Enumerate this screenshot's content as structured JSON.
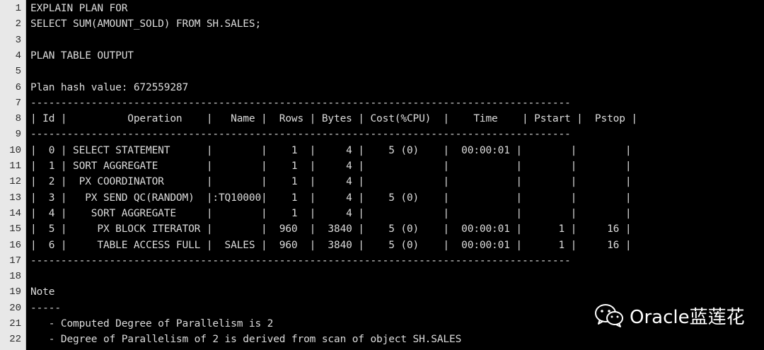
{
  "editor": {
    "lines": [
      {
        "num": "1",
        "text": "EXPLAIN PLAN FOR"
      },
      {
        "num": "2",
        "text": "SELECT SUM(AMOUNT_SOLD) FROM SH.SALES;"
      },
      {
        "num": "3",
        "text": ""
      },
      {
        "num": "4",
        "text": "PLAN TABLE OUTPUT"
      },
      {
        "num": "5",
        "text": ""
      },
      {
        "num": "6",
        "text": "Plan hash value: 672559287"
      },
      {
        "num": "7",
        "text": "-----------------------------------------------------------------------------------------"
      },
      {
        "num": "8",
        "text": "| Id |          Operation    |   Name |  Rows | Bytes | Cost(%CPU)  |    Time    | Pstart |  Pstop |"
      },
      {
        "num": "9",
        "text": "-----------------------------------------------------------------------------------------"
      },
      {
        "num": "10",
        "text": "|  0 | SELECT STATEMENT      |        |    1  |     4 |    5 (0)    |  00:00:01 |        |        |"
      },
      {
        "num": "11",
        "text": "|  1 | SORT AGGREGATE        |        |    1  |     4 |             |           |        |        |"
      },
      {
        "num": "12",
        "text": "|  2 |  PX COORDINATOR       |        |    1  |     4 |             |           |        |        |"
      },
      {
        "num": "13",
        "text": "|  3 |   PX SEND QC(RANDOM)  |:TQ10000|    1  |     4 |    5 (0)    |           |        |        |"
      },
      {
        "num": "14",
        "text": "|  4 |    SORT AGGREGATE     |        |    1  |     4 |             |           |        |        |"
      },
      {
        "num": "15",
        "text": "|  5 |     PX BLOCK ITERATOR |        |  960  |  3840 |    5 (0)    |  00:00:01 |      1 |     16 |"
      },
      {
        "num": "16",
        "text": "|  6 |     TABLE ACCESS FULL |  SALES |  960  |  3840 |    5 (0)    |  00:00:01 |      1 |     16 |"
      },
      {
        "num": "17",
        "text": "-----------------------------------------------------------------------------------------"
      },
      {
        "num": "18",
        "text": ""
      },
      {
        "num": "19",
        "text": "Note"
      },
      {
        "num": "20",
        "text": "-----"
      },
      {
        "num": "21",
        "text": "   - Computed Degree of Parallelism is 2"
      },
      {
        "num": "22",
        "text": "   - Degree of Parallelism of 2 is derived from scan of object SH.SALES"
      }
    ]
  },
  "watermark": {
    "icon": "wechat-icon",
    "text": "Oracle蓝莲花",
    "color": "#ffffff"
  }
}
